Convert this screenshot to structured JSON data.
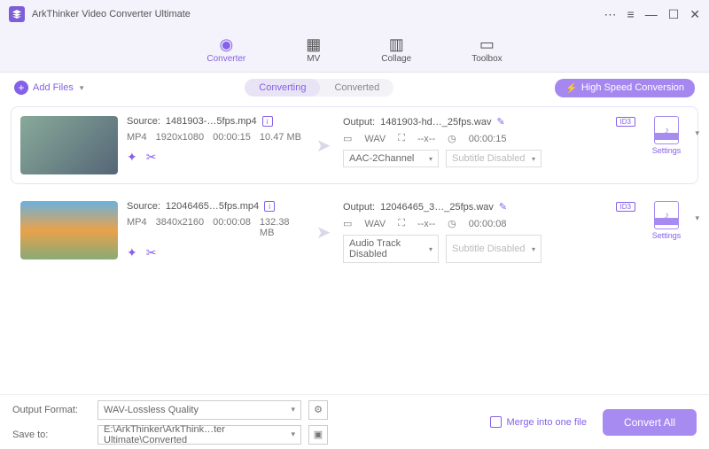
{
  "app_title": "ArkThinker Video Converter Ultimate",
  "tabs": {
    "converter": "Converter",
    "mv": "MV",
    "collage": "Collage",
    "toolbox": "Toolbox"
  },
  "subbar": {
    "add_files": "Add Files",
    "converting": "Converting",
    "converted": "Converted",
    "hs": "High Speed Conversion"
  },
  "items": [
    {
      "source_label": "Source:",
      "source_name": "1481903-…5fps.mp4",
      "format": "MP4",
      "resolution": "1920x1080",
      "duration": "00:00:15",
      "size": "10.47 MB",
      "output_label": "Output:",
      "output_name": "1481903-hd…_25fps.wav",
      "out_fmt": "WAV",
      "out_dim": "--x--",
      "out_dur": "00:00:15",
      "audio_sel": "AAC-2Channel",
      "sub_sel": "Subtitle Disabled",
      "settings": "Settings",
      "id3": "ID3"
    },
    {
      "source_label": "Source:",
      "source_name": "12046465…5fps.mp4",
      "format": "MP4",
      "resolution": "3840x2160",
      "duration": "00:00:08",
      "size": "132.38 MB",
      "output_label": "Output:",
      "output_name": "12046465_3…_25fps.wav",
      "out_fmt": "WAV",
      "out_dim": "--x--",
      "out_dur": "00:00:08",
      "audio_sel": "Audio Track Disabled",
      "sub_sel": "Subtitle Disabled",
      "settings": "Settings",
      "id3": "ID3"
    }
  ],
  "footer": {
    "output_format_label": "Output Format:",
    "output_format": "WAV-Lossless Quality",
    "save_to_label": "Save to:",
    "save_to": "E:\\ArkThinker\\ArkThink…ter Ultimate\\Converted",
    "merge": "Merge into one file",
    "convert_all": "Convert All"
  }
}
